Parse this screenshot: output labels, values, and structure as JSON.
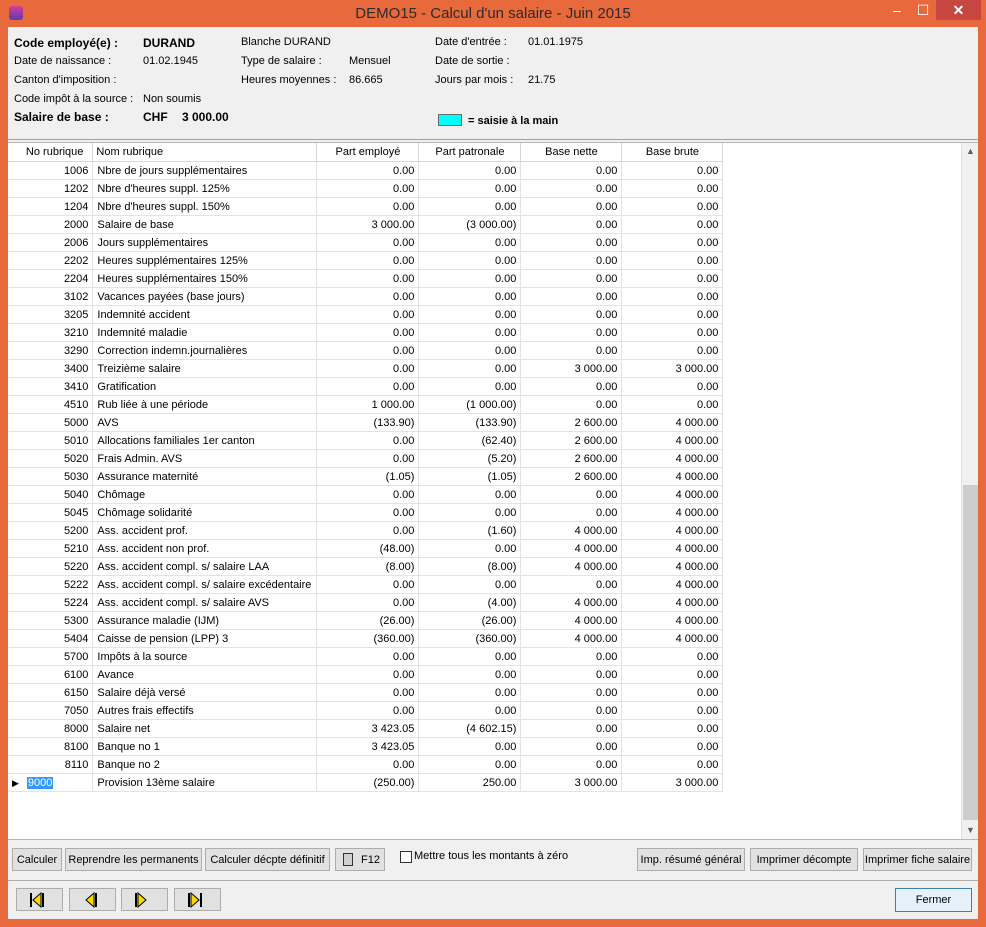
{
  "window": {
    "title": "DEMO15 - Calcul d'un salaire - Juin 2015",
    "min": "–",
    "max": "☐",
    "close": "✕"
  },
  "header": {
    "code_label": "Code employé(e) :",
    "code_value": "DURAND",
    "name": "Blanche DURAND",
    "date_entree_label": "Date d'entrée :",
    "date_entree_value": "01.01.1975",
    "naissance_label": "Date de naissance :",
    "naissance_value": "01.02.1945",
    "type_label": "Type de salaire :",
    "type_value": "Mensuel",
    "sortie_label": "Date de sortie :",
    "canton_label": "Canton d'imposition :",
    "heures_label": "Heures moyennes :",
    "heures_value": "86.665",
    "jours_label": "Jours par mois :",
    "jours_value": "21.75",
    "impot_label": "Code impôt à la source :",
    "impot_value": "Non soumis",
    "salaire_label": "Salaire de  base :",
    "salaire_currency": "CHF",
    "salaire_value": "3 000.00",
    "saisie_label": "= saisie à la main",
    "saisie_color": "#00ffff"
  },
  "grid": {
    "columns": [
      "No rubrique",
      "Nom rubrique",
      "Part employé",
      "Part patronale",
      "Base nette",
      "Base brute"
    ],
    "rows": [
      [
        "1006",
        "Nbre de jours supplémentaires",
        "0.00",
        "0.00",
        "0.00",
        "0.00"
      ],
      [
        "1202",
        "Nbre d'heures suppl. 125%",
        "0.00",
        "0.00",
        "0.00",
        "0.00"
      ],
      [
        "1204",
        "Nbre d'heures suppl. 150%",
        "0.00",
        "0.00",
        "0.00",
        "0.00"
      ],
      [
        "2000",
        "Salaire de base",
        "3 000.00",
        "(3 000.00)",
        "0.00",
        "0.00"
      ],
      [
        "2006",
        "Jours supplémentaires",
        "0.00",
        "0.00",
        "0.00",
        "0.00"
      ],
      [
        "2202",
        "Heures supplémentaires 125%",
        "0.00",
        "0.00",
        "0.00",
        "0.00"
      ],
      [
        "2204",
        "Heures supplémentaires 150%",
        "0.00",
        "0.00",
        "0.00",
        "0.00"
      ],
      [
        "3102",
        "Vacances payées (base jours)",
        "0.00",
        "0.00",
        "0.00",
        "0.00"
      ],
      [
        "3205",
        "Indemnité accident",
        "0.00",
        "0.00",
        "0.00",
        "0.00"
      ],
      [
        "3210",
        "Indemnité maladie",
        "0.00",
        "0.00",
        "0.00",
        "0.00"
      ],
      [
        "3290",
        "Correction indemn.journalières",
        "0.00",
        "0.00",
        "0.00",
        "0.00"
      ],
      [
        "3400",
        "Treizième salaire",
        "0.00",
        "0.00",
        "3 000.00",
        "3 000.00"
      ],
      [
        "3410",
        "Gratification",
        "0.00",
        "0.00",
        "0.00",
        "0.00"
      ],
      [
        "4510",
        "Rub liée à une période",
        "1 000.00",
        "(1 000.00)",
        "0.00",
        "0.00"
      ],
      [
        "5000",
        "AVS",
        "(133.90)",
        "(133.90)",
        "2 600.00",
        "4 000.00"
      ],
      [
        "5010",
        "Allocations familiales 1er canton",
        "0.00",
        "(62.40)",
        "2 600.00",
        "4 000.00"
      ],
      [
        "5020",
        "Frais Admin. AVS",
        "0.00",
        "(5.20)",
        "2 600.00",
        "4 000.00"
      ],
      [
        "5030",
        "Assurance maternité",
        "(1.05)",
        "(1.05)",
        "2 600.00",
        "4 000.00"
      ],
      [
        "5040",
        "Chômage",
        "0.00",
        "0.00",
        "0.00",
        "4 000.00"
      ],
      [
        "5045",
        "Chômage solidarité",
        "0.00",
        "0.00",
        "0.00",
        "4 000.00"
      ],
      [
        "5200",
        "Ass. accident prof.",
        "0.00",
        "(1.60)",
        "4 000.00",
        "4 000.00"
      ],
      [
        "5210",
        "Ass. accident non prof.",
        "(48.00)",
        "0.00",
        "4 000.00",
        "4 000.00"
      ],
      [
        "5220",
        "Ass. accident compl. s/ salaire LAA",
        "(8.00)",
        "(8.00)",
        "4 000.00",
        "4 000.00"
      ],
      [
        "5222",
        "Ass. accident compl. s/ salaire excédentaire",
        "0.00",
        "0.00",
        "0.00",
        "4 000.00"
      ],
      [
        "5224",
        "Ass. accident compl. s/ salaire AVS",
        "0.00",
        "(4.00)",
        "4 000.00",
        "4 000.00"
      ],
      [
        "5300",
        "Assurance maladie (IJM)",
        "(26.00)",
        "(26.00)",
        "4 000.00",
        "4 000.00"
      ],
      [
        "5404",
        "Caisse de pension (LPP) 3",
        "(360.00)",
        "(360.00)",
        "4 000.00",
        "4 000.00"
      ],
      [
        "5700",
        "Impôts à la source",
        "0.00",
        "0.00",
        "0.00",
        "0.00"
      ],
      [
        "6100",
        "Avance",
        "0.00",
        "0.00",
        "0.00",
        "0.00"
      ],
      [
        "6150",
        "Salaire déjà versé",
        "0.00",
        "0.00",
        "0.00",
        "0.00"
      ],
      [
        "7050",
        "Autres frais effectifs",
        "0.00",
        "0.00",
        "0.00",
        "0.00"
      ],
      [
        "8000",
        "Salaire net",
        "3 423.05",
        "(4 602.15)",
        "0.00",
        "0.00"
      ],
      [
        "8100",
        "Banque no 1",
        "3 423.05",
        "0.00",
        "0.00",
        "0.00"
      ],
      [
        "8110",
        "Banque no 2",
        "0.00",
        "0.00",
        "0.00",
        "0.00"
      ],
      [
        "9000",
        "Provision 13ème salaire",
        "(250.00)",
        "250.00",
        "3 000.00",
        "3 000.00"
      ]
    ]
  },
  "buttons": {
    "calculer": "Calculer",
    "reprendre": "Reprendre les permanents",
    "calculer_def": "Calculer décpte définitif",
    "f12": "F12",
    "zero_label": "Mettre tous les montants à zéro",
    "imp_resume": "Imp. résumé général",
    "imprimer_decompte": "Imprimer  décompte",
    "imprimer_fiche": "Imprimer fiche salaire",
    "fermer": "Fermer"
  }
}
